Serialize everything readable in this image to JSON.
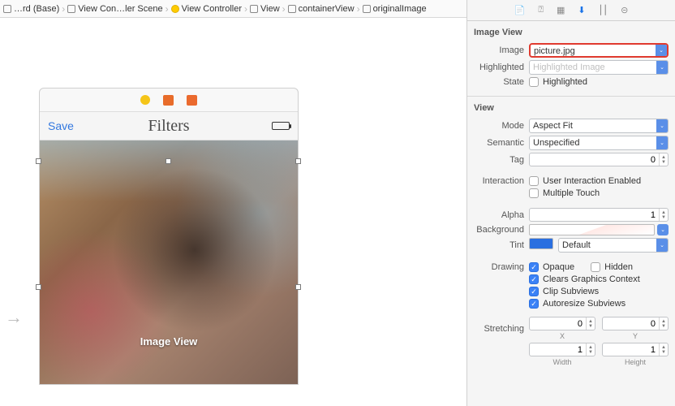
{
  "breadcrumb": [
    {
      "label": "…rd (Base)"
    },
    {
      "label": "View Con…ler Scene"
    },
    {
      "label": "View Controller"
    },
    {
      "label": "View"
    },
    {
      "label": "containerView"
    },
    {
      "label": "originalImage"
    }
  ],
  "device": {
    "save": "Save",
    "title": "Filters",
    "imageview_label": "Image View"
  },
  "inspector": {
    "section_imageview": "Image View",
    "image_label": "Image",
    "image_value": "picture.jpg",
    "highlighted_label": "Highlighted",
    "highlighted_placeholder": "Highlighted Image",
    "state_label": "State",
    "state_cb": "Highlighted",
    "section_view": "View",
    "mode_label": "Mode",
    "mode_value": "Aspect Fit",
    "semantic_label": "Semantic",
    "semantic_value": "Unspecified",
    "tag_label": "Tag",
    "tag_value": "0",
    "interaction_label": "Interaction",
    "interaction_cb1": "User Interaction Enabled",
    "interaction_cb2": "Multiple Touch",
    "alpha_label": "Alpha",
    "alpha_value": "1",
    "background_label": "Background",
    "tint_label": "Tint",
    "tint_value": "Default",
    "drawing_label": "Drawing",
    "drawing_cb1": "Opaque",
    "drawing_cb2": "Hidden",
    "drawing_cb3": "Clears Graphics Context",
    "drawing_cb4": "Clip Subviews",
    "drawing_cb5": "Autoresize Subviews",
    "stretching_label": "Stretching",
    "stretch_x": "0",
    "stretch_y": "0",
    "stretch_x_lbl": "X",
    "stretch_y_lbl": "Y",
    "stretch_w": "1",
    "stretch_h": "1",
    "stretch_w_lbl": "Width",
    "stretch_h_lbl": "Height"
  }
}
